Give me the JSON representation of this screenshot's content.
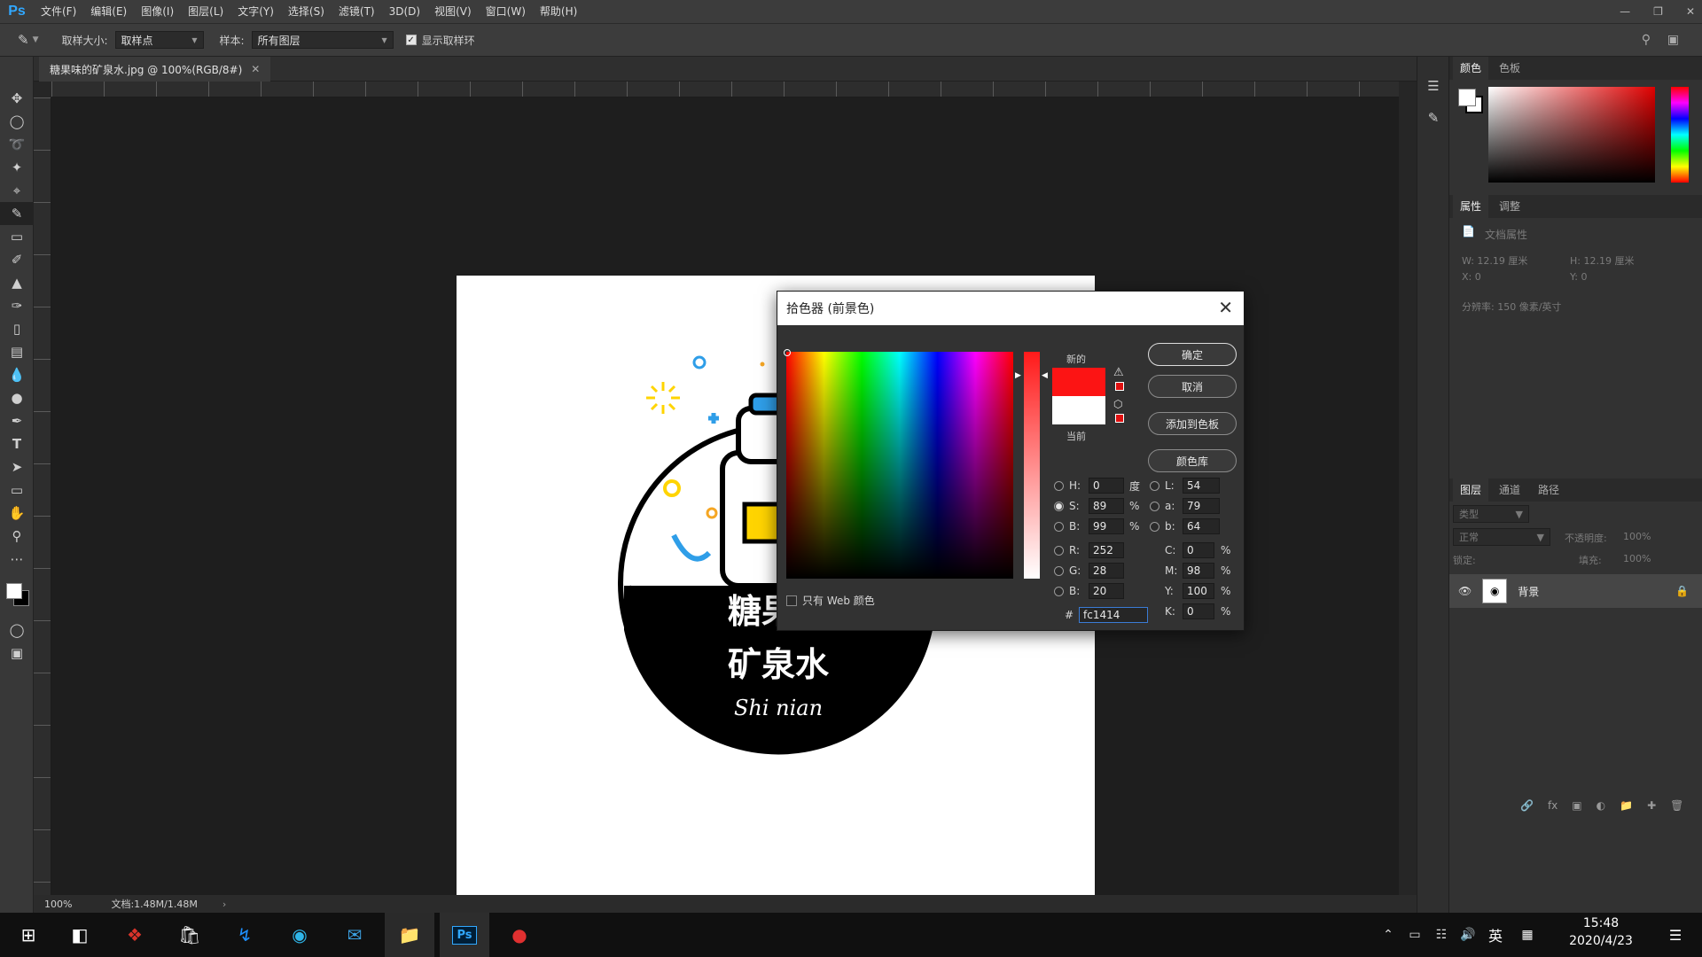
{
  "app": {
    "logo": "Ps",
    "menu": [
      "文件(F)",
      "编辑(E)",
      "图像(I)",
      "图层(L)",
      "文字(Y)",
      "选择(S)",
      "滤镜(T)",
      "3D(D)",
      "视图(V)",
      "窗口(W)",
      "帮助(H)"
    ]
  },
  "options": {
    "sample_size_label": "取样大小:",
    "sample_size_value": "取样点",
    "sample_label": "样本:",
    "sample_value": "所有图层",
    "show_ring_label": "显示取样环"
  },
  "document": {
    "tab_title": "糖果味的矿泉水.jpg @ 100%(RGB/8#)",
    "logo_line1": "糖果味",
    "logo_line2": "矿泉水",
    "logo_sub": "Shi nian"
  },
  "status": {
    "zoom": "100%",
    "doc_size": "文档:1.48M/1.48M"
  },
  "right_panel": {
    "color_tabs": [
      "颜色",
      "色板"
    ],
    "props_tabs": [
      "属性",
      "调整"
    ],
    "doc_props_label": "文档属性",
    "w_label": "W:  12.19 厘米",
    "h_label": "H:  12.19 厘米",
    "x_label": "X:  0",
    "y_label": "Y:  0",
    "resolution": "分辨率: 150 像素/英寸",
    "layer_tabs": [
      "图层",
      "通道",
      "路径"
    ],
    "filter_kind": "类型",
    "blend_mode": "正常",
    "opacity_label": "不透明度:",
    "opacity_value": "100%",
    "lock_label": "锁定:",
    "fill_label": "填充:",
    "fill_value": "100%",
    "layer_name": "背景"
  },
  "color_picker": {
    "title": "拾色器 (前景色)",
    "new_label": "新的",
    "current_label": "当前",
    "ok": "确定",
    "cancel": "取消",
    "add_swatch": "添加到色板",
    "color_library": "颜色库",
    "web_only": "只有 Web 颜色",
    "h_label": "H:",
    "h_value": "0",
    "h_unit": "度",
    "s_label": "S:",
    "s_value": "89",
    "s_unit": "%",
    "b_label": "B:",
    "b_value": "99",
    "b_unit": "%",
    "r_label": "R:",
    "r_value": "252",
    "g_label": "G:",
    "g_value": "28",
    "bb_label": "B:",
    "bb_value": "20",
    "l_label": "L:",
    "l_value": "54",
    "a_label": "a:",
    "a_value": "79",
    "lab_b_label": "b:",
    "lab_b_value": "64",
    "c_label": "C:",
    "c_value": "0",
    "c_unit": "%",
    "m_label": "M:",
    "m_value": "98",
    "m_unit": "%",
    "y_label": "Y:",
    "y_value": "100",
    "y_unit": "%",
    "k_label": "K:",
    "k_value": "0",
    "k_unit": "%",
    "hex_label": "#",
    "hex_value": "fc1414",
    "new_color": "#fc1414",
    "current_color": "#ffffff"
  },
  "taskbar": {
    "time": "15:48",
    "date": "2020/4/23",
    "ime": "英"
  }
}
